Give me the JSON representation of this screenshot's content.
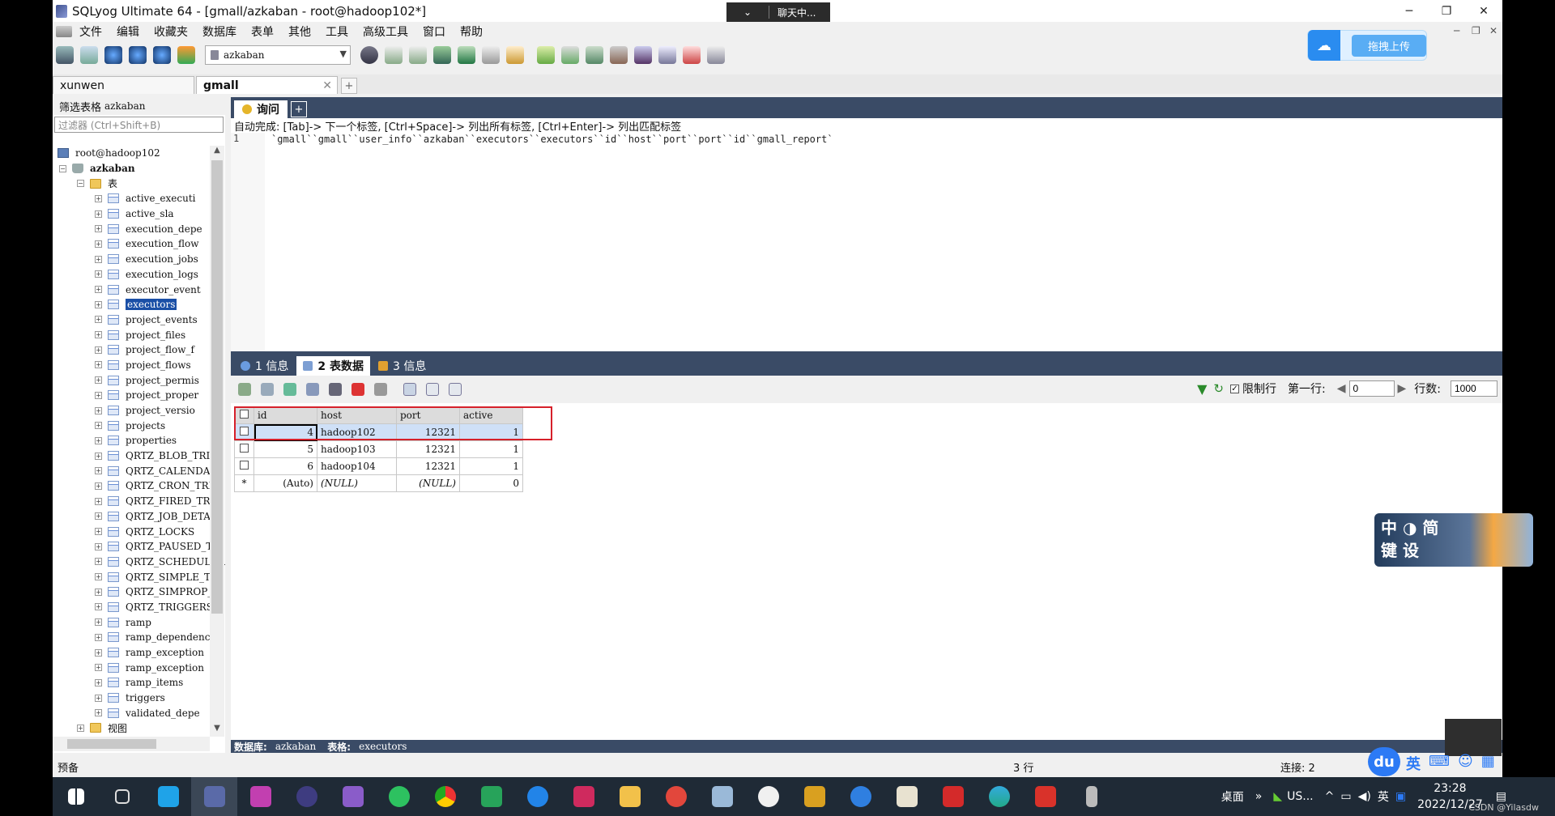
{
  "window": {
    "title": "SQLyog Ultimate 64 - [gmall/azkaban - root@hadoop102*]",
    "chat_label": "聊天中..."
  },
  "menu": [
    "文件",
    "编辑",
    "收藏夹",
    "数据库",
    "表单",
    "其他",
    "工具",
    "高级工具",
    "窗口",
    "帮助"
  ],
  "toolbar": {
    "db_select": "azkaban"
  },
  "upload": {
    "label": "拖拽上传"
  },
  "conn_tabs": [
    {
      "label": "xunwen"
    },
    {
      "label": "gmall"
    }
  ],
  "left": {
    "filter_label": "筛选表格",
    "db": "azkaban",
    "filter_placeholder": "过滤器 (Ctrl+Shift+B)",
    "server": "root@hadoop102",
    "database": "azkaban",
    "tables_folder": "表",
    "views_folder": "视图",
    "tables": [
      "active_executi",
      "active_sla",
      "execution_depe",
      "execution_flow",
      "execution_jobs",
      "execution_logs",
      "executor_event",
      "executors",
      "project_events",
      "project_files",
      "project_flow_f",
      "project_flows",
      "project_permis",
      "project_proper",
      "project_versio",
      "projects",
      "properties",
      "QRTZ_BLOB_TRIG",
      "QRTZ_CALENDARS",
      "QRTZ_CRON_TRIG",
      "QRTZ_FIRED_TRI",
      "QRTZ_JOB_DETAI",
      "QRTZ_LOCKS",
      "QRTZ_PAUSED_TR",
      "QRTZ_SCHEDULER",
      "QRTZ_SIMPLE_TR",
      "QRTZ_SIMPROP_T",
      "QRTZ_TRIGGERS",
      "ramp",
      "ramp_dependenc",
      "ramp_exception",
      "ramp_exception",
      "ramp_items",
      "triggers",
      "validated_depe"
    ],
    "selected": "executors"
  },
  "query": {
    "tab": "询问",
    "hint": "自动完成: [Tab]-> 下一个标签, [Ctrl+Space]-> 列出所有标签, [Ctrl+Enter]-> 列出匹配标签",
    "line_no": "1",
    "code": "`gmall``gmall``user_info``azkaban``executors``executors``id``host``port``port``id``gmall_report`"
  },
  "result_tabs": [
    {
      "label": "1 信息"
    },
    {
      "label": "2 表数据"
    },
    {
      "label": "3 信息"
    }
  ],
  "result_toolbar": {
    "limit_label": "限制行",
    "first_row_label": "第一行:",
    "first_row": "0",
    "rows_label": "行数:",
    "rows": "1000"
  },
  "grid": {
    "columns": [
      "id",
      "host",
      "port",
      "active"
    ],
    "rows": [
      [
        "4",
        "hadoop102",
        "12321",
        "1"
      ],
      [
        "5",
        "hadoop103",
        "12321",
        "1"
      ],
      [
        "6",
        "hadoop104",
        "12321",
        "1"
      ],
      [
        "(Auto)",
        "(NULL)",
        "(NULL)",
        "0"
      ]
    ]
  },
  "status": {
    "db_label": "数据库:",
    "db": "azkaban",
    "table_label": "表格:",
    "table": "executors"
  },
  "app_status": {
    "left": "预备",
    "rows": "3 行",
    "conn": "连接: 2"
  },
  "ime": {
    "line1": "中 ◑ 简",
    "line2": "键 设"
  },
  "tray": {
    "du": "du",
    "lang": "英",
    "net": "US...",
    "desk": "桌面",
    "ime_lang": "英",
    "time": "23:28",
    "date": "2022/12/27",
    "watermark": "CSDN @Yilasdw"
  }
}
